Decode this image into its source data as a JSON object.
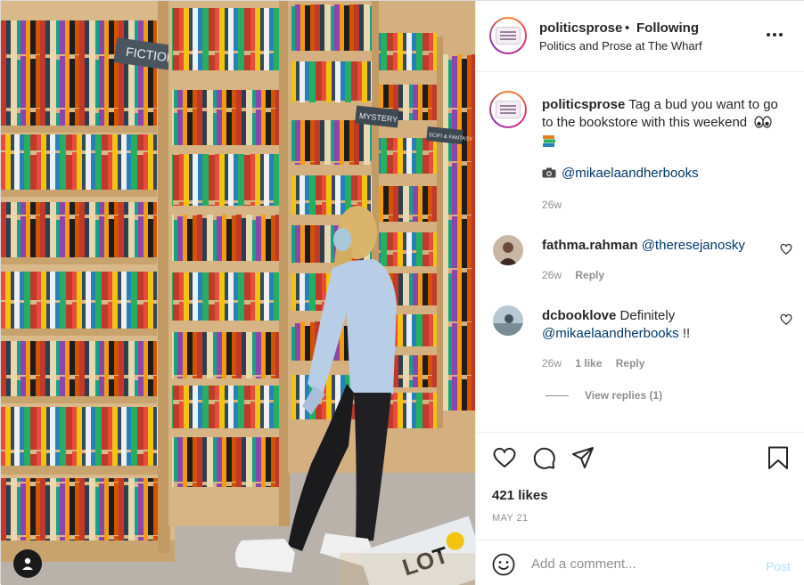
{
  "post": {
    "username": "politicsprose",
    "separator": "•",
    "follow_status": "Following",
    "location": "Politics and Prose at The Wharf",
    "photo_description_icon": "person-tag-icon"
  },
  "caption": {
    "username": "politicsprose",
    "text": "Tag a bud you want to go to the bookstore with this weekend",
    "emoji_1": "eyes-icon",
    "emoji_2": "books-icon",
    "camera_emoji": "camera-icon",
    "mention": "@mikaelaandherbooks",
    "time": "26w"
  },
  "comments": [
    {
      "username": "fathma.rahman",
      "text": "",
      "mention": "@theresejanosky",
      "time": "26w",
      "likes": "",
      "reply_label": "Reply"
    },
    {
      "username": "dcbooklove",
      "text": "Definitely",
      "mention": "@mikaelaandherbooks",
      "suffix": "!!",
      "time": "26w",
      "likes": "1 like",
      "reply_label": "Reply"
    }
  ],
  "view_replies": "View replies (1)",
  "engagement": {
    "likes": "421 likes",
    "date": "MAY 21"
  },
  "add_comment": {
    "placeholder": "Add a comment...",
    "post_label": "Post"
  },
  "photo_text": {
    "fiction_sign": "FICTION",
    "mystery_sign": "MYSTERY",
    "scifi_sign": "SCIFI & FANTASY",
    "book_cover": "LOT"
  },
  "colors": {
    "link": "#00376b",
    "secondary": "#8e8e8e",
    "post_button_disabled": "#b2dffc"
  }
}
